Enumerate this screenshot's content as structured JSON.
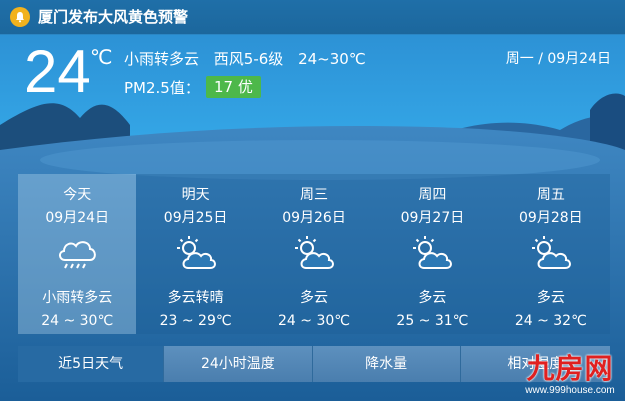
{
  "alert": {
    "text": "厦门发布大风黄色预警"
  },
  "current": {
    "temperature": "24",
    "unit": "℃",
    "condition": "小雨转多云",
    "wind": "西风5-6级",
    "range": "24~30℃",
    "pm_label": "PM2.5值：",
    "pm_value": "17 优",
    "date": "周一 / 09月24日"
  },
  "forecast": [
    {
      "day": "今天",
      "date": "09月24日",
      "icon": "rain-cloud-icon",
      "condition": "小雨转多云",
      "range": "24 ~ 30℃"
    },
    {
      "day": "明天",
      "date": "09月25日",
      "icon": "sun-cloud-icon",
      "condition": "多云转晴",
      "range": "23 ~ 29℃"
    },
    {
      "day": "周三",
      "date": "09月26日",
      "icon": "sun-cloud-icon",
      "condition": "多云",
      "range": "24 ~ 30℃"
    },
    {
      "day": "周四",
      "date": "09月27日",
      "icon": "sun-cloud-icon",
      "condition": "多云",
      "range": "25 ~ 31℃"
    },
    {
      "day": "周五",
      "date": "09月28日",
      "icon": "sun-cloud-icon",
      "condition": "多云",
      "range": "24 ~ 32℃"
    }
  ],
  "tabs": [
    {
      "label": "近5日天气"
    },
    {
      "label": "24小时温度"
    },
    {
      "label": "降水量"
    },
    {
      "label": "相对湿度"
    }
  ],
  "watermark": {
    "logo": "九房网",
    "url": "www.999house.com"
  },
  "colors": {
    "pm_good": "#4db84a",
    "alert_bell": "#f2b21d",
    "watermark": "#e02020"
  }
}
